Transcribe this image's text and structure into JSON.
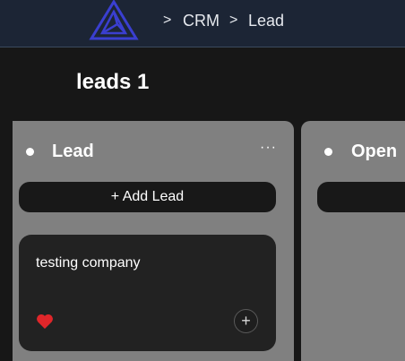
{
  "breadcrumb": {
    "separator": ">",
    "items": [
      "CRM",
      "Lead"
    ]
  },
  "board": {
    "title": "leads 1"
  },
  "columns": [
    {
      "title": "Lead",
      "menu_icon": "ellipsis-icon",
      "add_label": "+ Add Lead",
      "cards": [
        {
          "title": "testing company",
          "liked": true
        }
      ]
    },
    {
      "title": "Open"
    }
  ],
  "colors": {
    "topbar": "#1c2535",
    "logo": "#3a3fd0",
    "background": "#171717",
    "column": "#808080",
    "card": "#222222",
    "heart": "#e0262a"
  }
}
